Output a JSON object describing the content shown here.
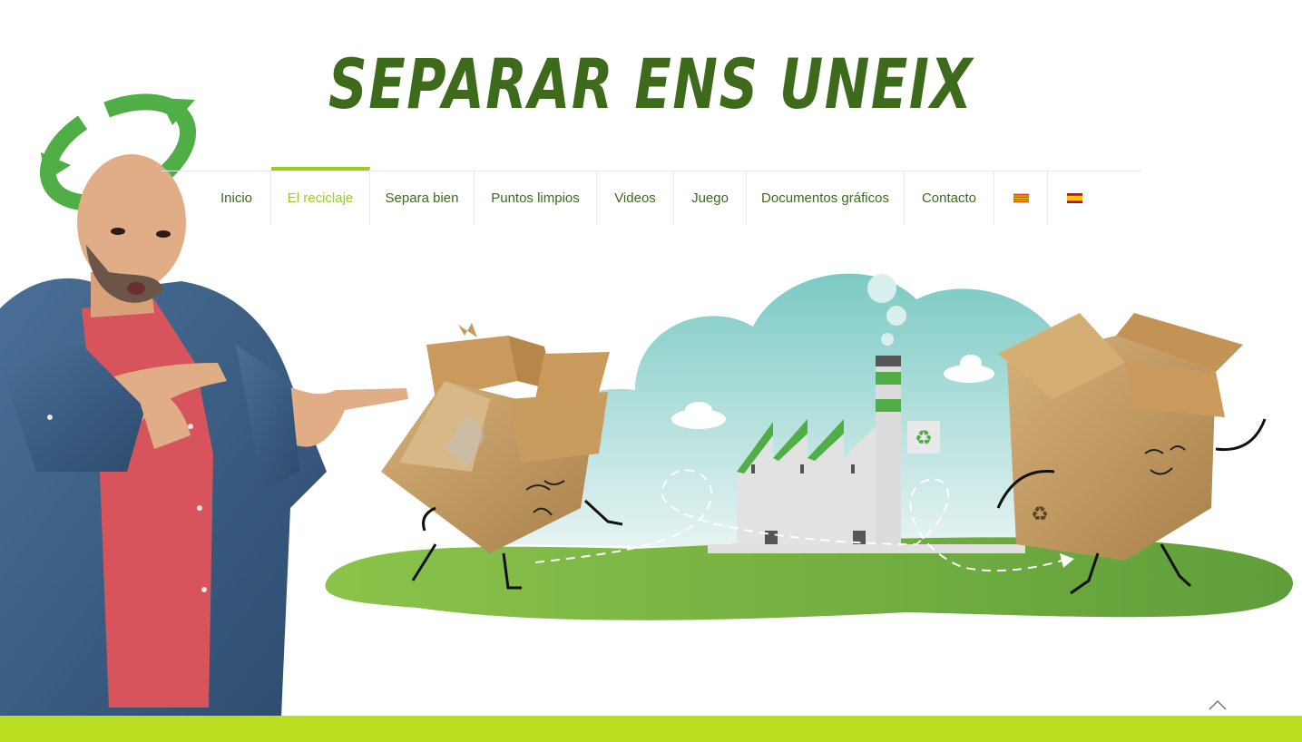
{
  "site": {
    "title": "SEPARAR ENS UNEIX"
  },
  "nav": {
    "items": [
      {
        "label": "Inicio",
        "active": false
      },
      {
        "label": "El reciclaje",
        "active": true
      },
      {
        "label": "Separa bien",
        "active": false
      },
      {
        "label": "Puntos limpios",
        "active": false
      },
      {
        "label": "Videos",
        "active": false
      },
      {
        "label": "Juego",
        "active": false
      },
      {
        "label": "Documentos gráficos",
        "active": false
      },
      {
        "label": "Contacto",
        "active": false
      }
    ],
    "languages": [
      "catalan-flag-icon",
      "spanish-flag-icon"
    ]
  },
  "colors": {
    "brand_dark_green": "#3d6a1b",
    "accent_lime": "#9acd1f",
    "footer_bar": "#b9de1f"
  },
  "icons": {
    "scroll_top": "chevron-up-icon",
    "recycle_halo": "recycle-arrows-icon"
  }
}
